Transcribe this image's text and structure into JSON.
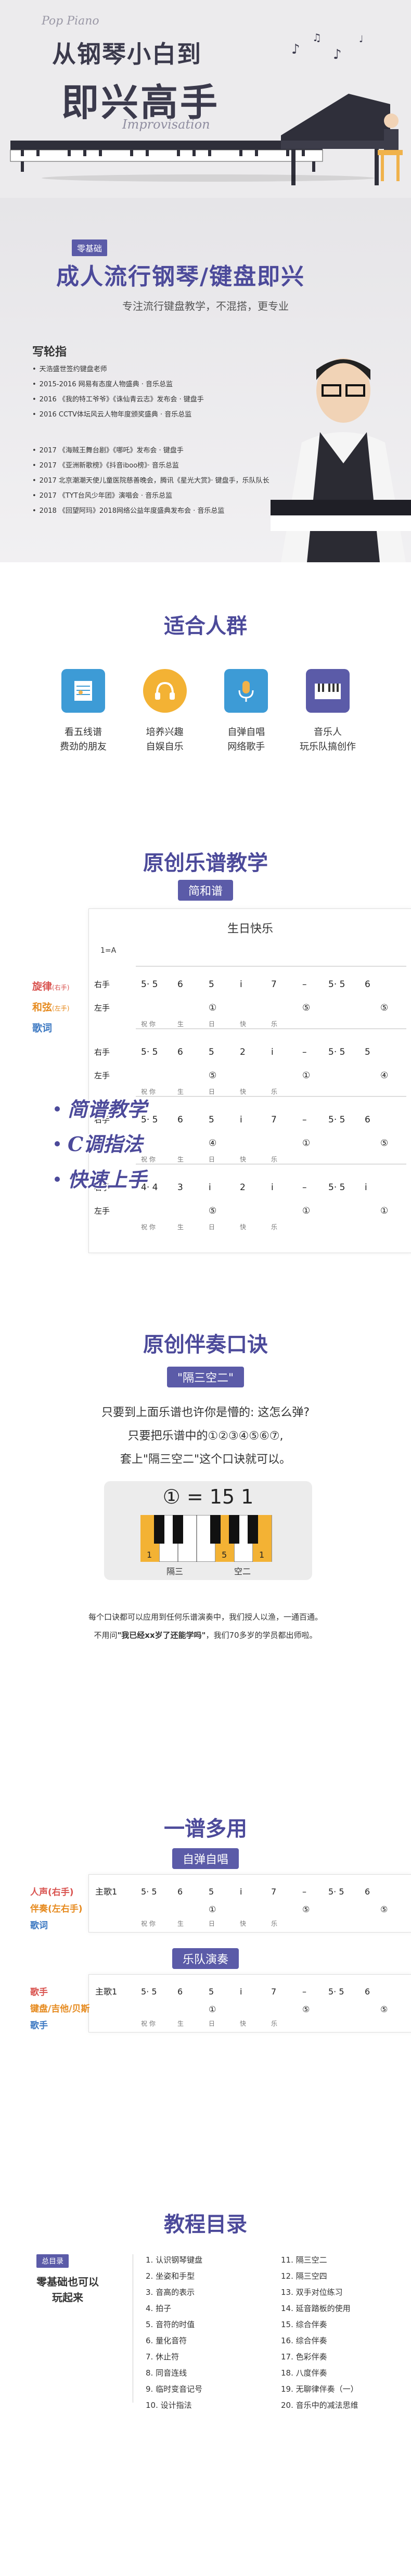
{
  "hero": {
    "deco_text": "Pop Piano",
    "title_line1": "从钢琴小白到",
    "title_line2": "即兴高手",
    "subtitle_en": "Improvisation",
    "colors": {
      "background": "#ECEBED",
      "title": "#3B3A4C"
    }
  },
  "teacher": {
    "level_badge": "零基础",
    "course_title": "成人流行钢琴/键盘即兴",
    "course_desc": "专注流行键盘教学，不混搭，更专业",
    "name": "写轮指",
    "bio": [
      "天浩盛世签约键盘老师",
      "2015-2016 网易有态度人物盛典 · 音乐总监",
      "2016 《我的特工爷爷》《诛仙青云志》发布会 · 键盘手",
      "2016 CCTV体坛风云人物年度颁奖盛典 · 音乐总监",
      "2017 《海贼王舞台剧》《哪吒》发布会 · 键盘手",
      "2017 《亚洲新歌榜》《抖音iboo榜》· 音乐总监",
      "2017 北京潮潮天使儿童医院慈善晚会，腾讯《星光大赏》· 键盘手，乐队队长",
      "2017 《TYT台风少年团》演唱会 · 音乐总监",
      "2018 《回望阿玛》2018网络公益年度盛典发布会 · 音乐总监"
    ]
  },
  "suitable": {
    "title": "适合人群",
    "cards": [
      {
        "icon": "staff-paper-icon",
        "line1": "看五线谱",
        "line2": "费劲的朋友",
        "color": "#3D9BD6"
      },
      {
        "icon": "headphones-icon",
        "line1": "培养兴趣",
        "line2": "自娱自乐",
        "color": "#F3B234"
      },
      {
        "icon": "microphone-icon",
        "line1": "自弹自唱",
        "line2": "网络歌手",
        "color": "#3D9BD6"
      },
      {
        "icon": "keyboard-icon",
        "line1": "音乐人",
        "line2": "玩乐队搞创作",
        "color": "#5B5BA8"
      }
    ]
  },
  "score": {
    "title": "原创乐谱教学",
    "pill": "简和谱",
    "song_title": "生日快乐",
    "labels": {
      "melody": "旋律",
      "melody_hand": "(右手)",
      "chord": "和弦",
      "chord_hand": "(左手)",
      "lyrics": "歌词"
    },
    "features": [
      "简谱教学",
      "C调指法",
      "快速上手"
    ],
    "key_sig": "1=A",
    "lyric_text": "祝 你 生 日 快 乐"
  },
  "accompany": {
    "title": "原创伴奏口诀",
    "pill": "\"隔三空二\"",
    "line1": "只要到上面乐谱也许你是懵的: 这怎么弹?",
    "line2": "只要把乐谱中的①②③④⑤⑥⑦,",
    "line3": "套上\"隔三空二\"这个口诀就可以。",
    "formula_left": "①",
    "formula_eq": "= 15 1",
    "key_label_1": "隔三",
    "key_label_2": "空二",
    "note1": "每个口诀都可以应用到任何乐谱演奏中，我们授人以渔，一通百通。",
    "note2_pre": "不用问",
    "note2_bold": "\"我已经xx岁了还能学吗\"",
    "note2_post": "，我们70多岁的学员都出师啦。"
  },
  "multi": {
    "title": "一谱多用",
    "pill1": "自弹自唱",
    "pill2": "乐队演奏",
    "labels1": [
      "人声(右手)",
      "伴奏(左右手)",
      "歌词"
    ],
    "labels2": [
      "歌手",
      "键盘/吉他/贝斯",
      "歌手"
    ]
  },
  "catalog": {
    "title": "教程目录",
    "badge": "总目录",
    "left_line1": "零基础也可以",
    "left_line2": "玩起来",
    "col1": [
      "1. 认识钢琴键盘",
      "2. 坐姿和手型",
      "3. 音高的表示",
      "4. 拍子",
      "5. 音符的时值",
      "6. 量化音符",
      "7. 休止符",
      "8. 同音连线",
      "9. 临时变音记号",
      "10. 设计指法"
    ],
    "col2": [
      "11. 隔三空二",
      "12. 隔三空四",
      "13. 双手对位练习",
      "14. 延音踏板的使用",
      "15. 综合伴奏",
      "16. 综合伴奏",
      "17. 色彩伴奏",
      "18. 八度伴奏",
      "19. 无聊律伴奏（一）",
      "20. 音乐中的减法思维"
    ]
  }
}
